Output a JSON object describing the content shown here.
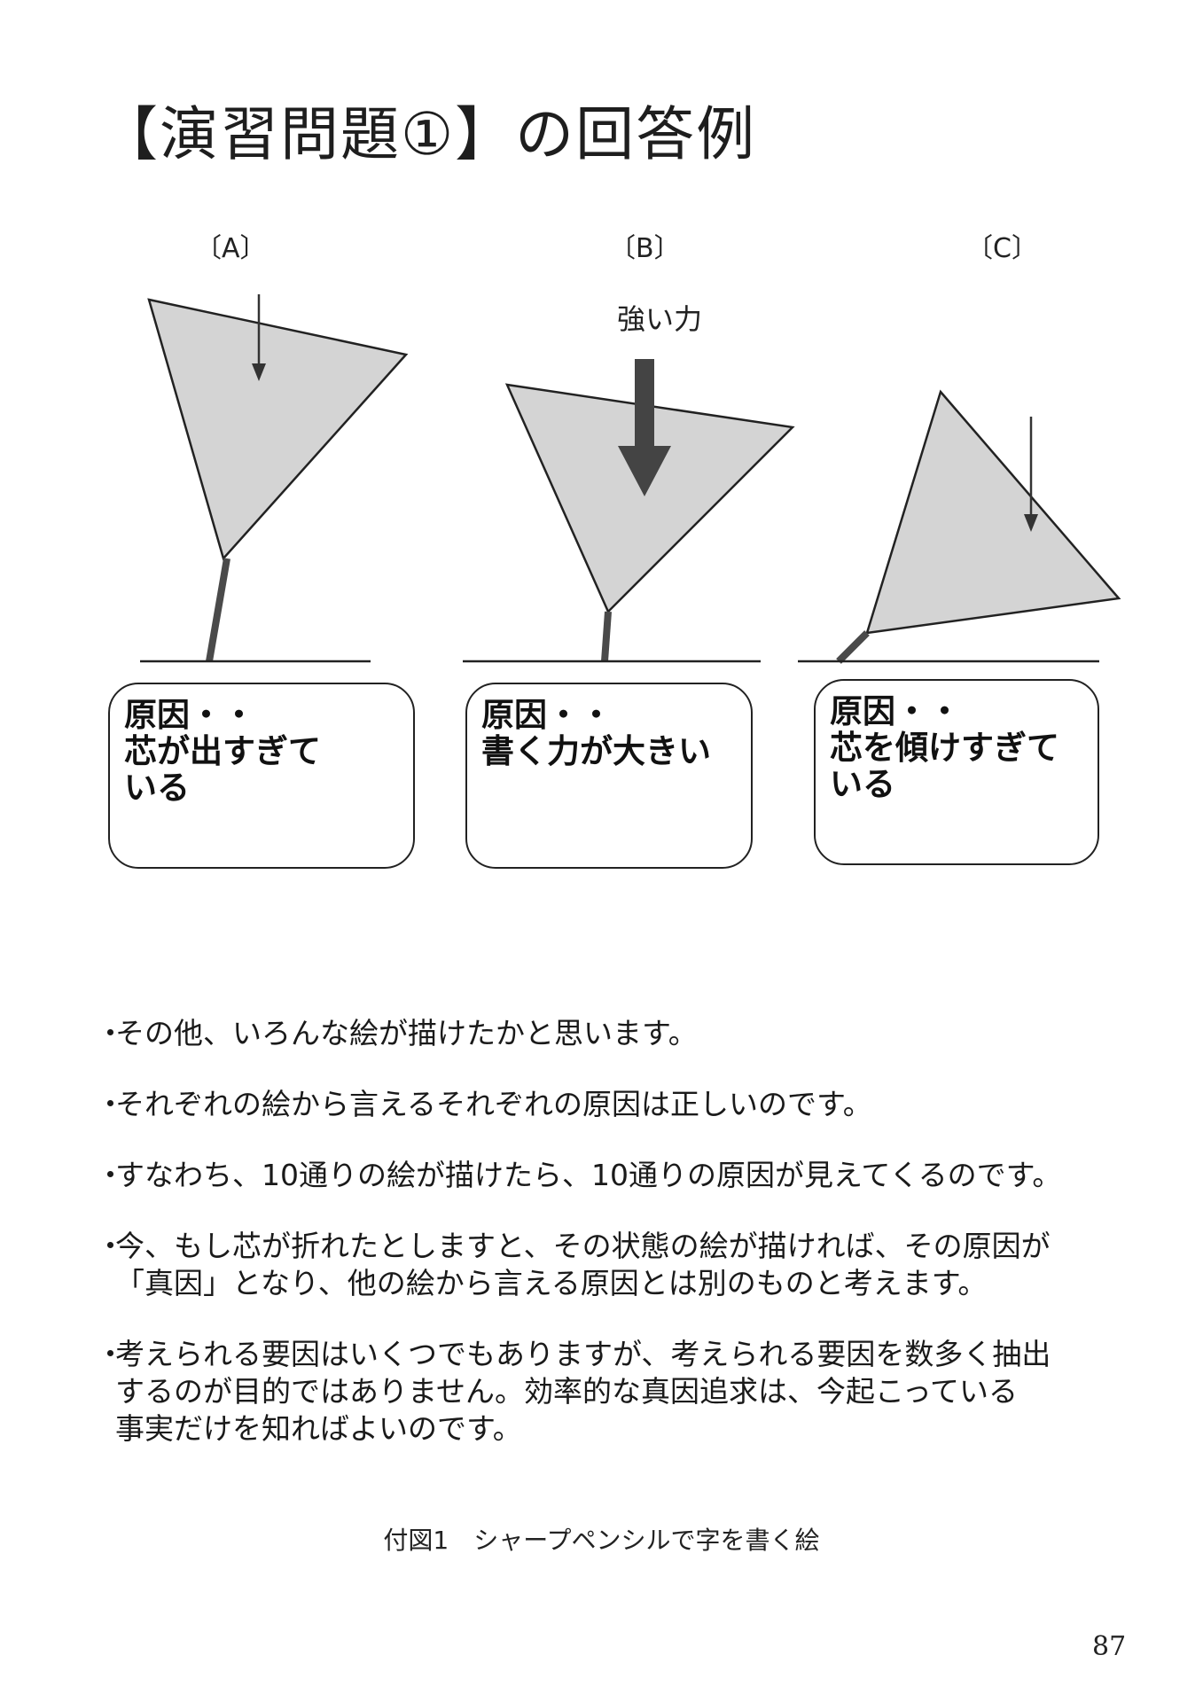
{
  "title": "【演習問題①】の回答例",
  "panels": [
    {
      "label": "〔A〕",
      "cause_lines": [
        "原因・・",
        "芯が出すぎて",
        "いる"
      ]
    },
    {
      "label": "〔B〕",
      "force_label": "強い力",
      "cause_lines": [
        "原因・・",
        "書く力が大きい"
      ]
    },
    {
      "label": "〔C〕",
      "cause_lines": [
        "原因・・",
        "芯を傾けすぎて",
        "いる"
      ]
    }
  ],
  "bullets": [
    "その他、いろんな絵が描けたかと思います。",
    "それぞれの絵から言えるそれぞれの原因は正しいのです。",
    "すなわち、10通りの絵が描けたら、10通りの原因が見えてくるのです。",
    "今、もし芯が折れたとしますと、その状態の絵が描ければ、その原因が\n「真因」となり、他の絵から言える原因とは別のものと考えます。",
    "考えられる要因はいくつでもありますが、考えられる要因を数多く抽出\nするのが目的ではありません。効率的な真因追求は、今起こっている\n事実だけを知ればよいのです。"
  ],
  "caption": "付図1　シャープペンシルで字を書く絵",
  "page_number": "87",
  "colors": {
    "pencil_fill": "#d4d4d4",
    "lead": "#4a4a4a",
    "line": "#222222"
  }
}
